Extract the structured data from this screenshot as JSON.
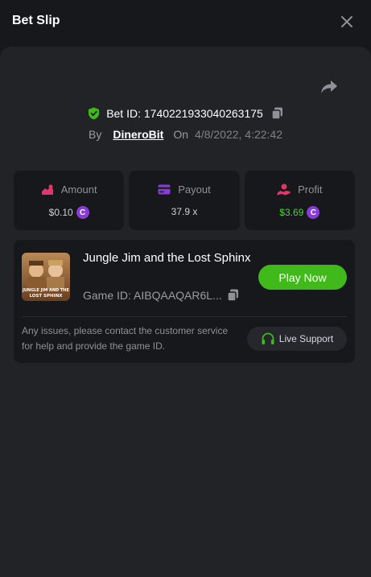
{
  "header": {
    "title": "Bet Slip"
  },
  "bet": {
    "id_label": "Bet ID: 1740221933040263175",
    "by_label": "By",
    "username": "DineroBit",
    "on_label": "On",
    "datetime": "4/8/2022, 4:22:42"
  },
  "stats": [
    {
      "label": "Amount",
      "value": "$0.10",
      "coin": true,
      "icon": "amount-icon",
      "icon_color": "#e0366a"
    },
    {
      "label": "Payout",
      "value": "37.9 x",
      "coin": false,
      "icon": "card-icon",
      "icon_color": "#8a3ad8"
    },
    {
      "label": "Profit",
      "value": "$3.69",
      "coin": true,
      "icon": "profit-icon",
      "icon_color": "#e0366a",
      "value_color": "#4cd137"
    }
  ],
  "coin_symbol": "C",
  "game": {
    "name": "Jungle Jim and the Lost Sphinx",
    "id_label": "Game ID: AIBQAAQAR6L...",
    "thumb_text_1": "JUNGLE JIM AND THE",
    "thumb_text_2": "LOST SPHINX",
    "play_label": "Play Now"
  },
  "support": {
    "text": "Any issues, please contact the customer service for help and provide the game ID.",
    "button_label": "Live Support"
  },
  "colors": {
    "accent_green": "#3fba1a",
    "coin_purple": "#8a3ad8",
    "shield_green": "#3fba1a"
  }
}
